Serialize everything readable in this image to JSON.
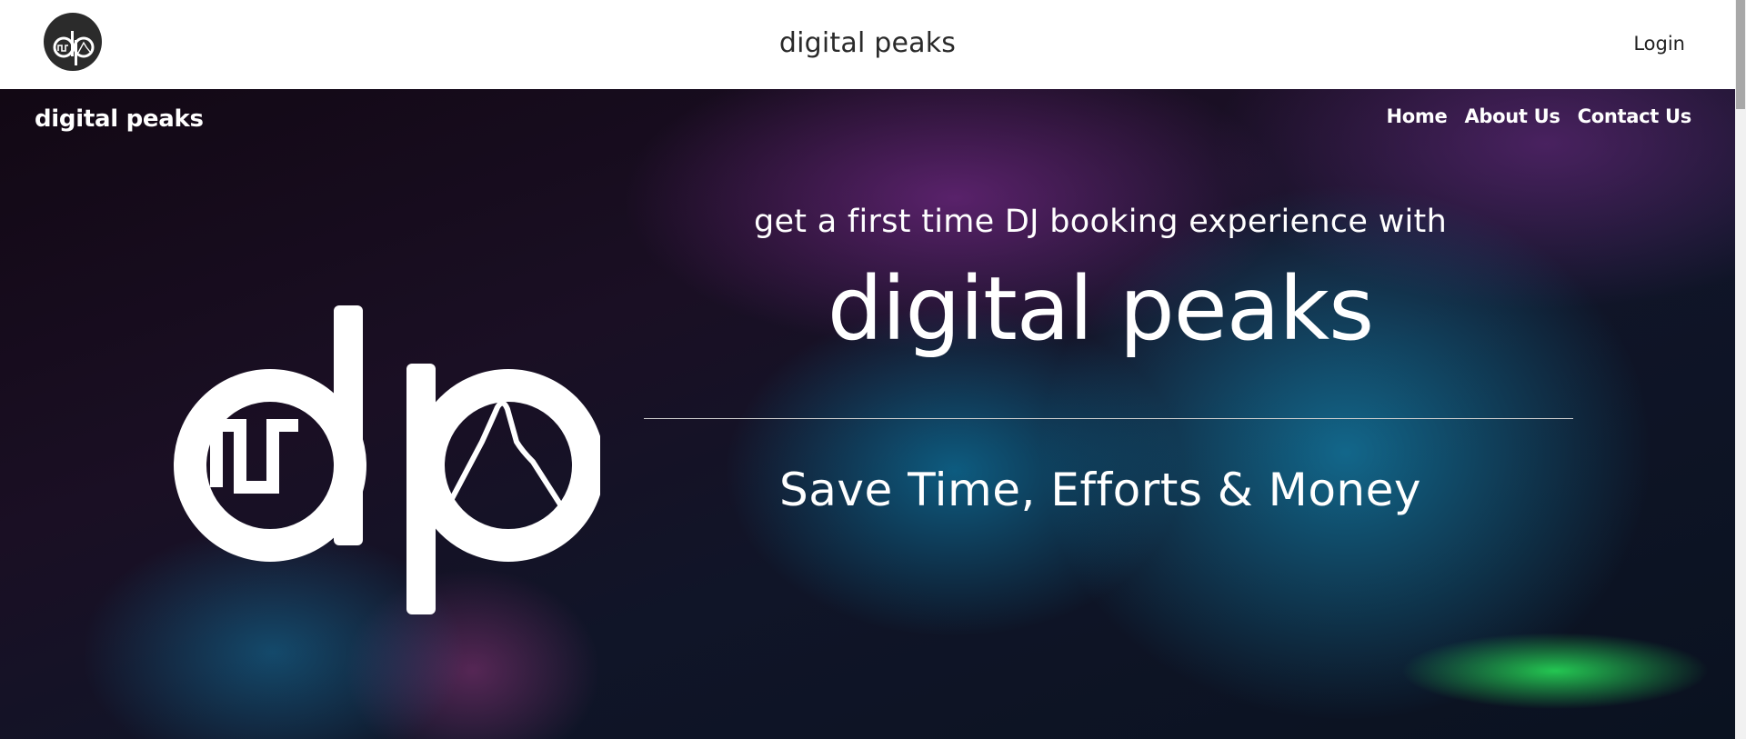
{
  "header": {
    "title": "digital peaks",
    "login_label": "Login"
  },
  "hero": {
    "brand": "digital peaks",
    "nav": [
      "Home",
      "About Us",
      "Contact Us"
    ],
    "tagline": "get a first time DJ booking experience with",
    "title": "digital peaks",
    "subheading": "Save Time, Efforts & Money"
  },
  "logo": {
    "icon": "dp-logo-icon"
  },
  "colors": {
    "header_bg": "#ffffff",
    "logo_circle": "#2b2b2b",
    "hero_text": "#ffffff",
    "accent_blue": "#14aadc",
    "accent_green": "#28e65a",
    "accent_purple": "#6e2882"
  }
}
